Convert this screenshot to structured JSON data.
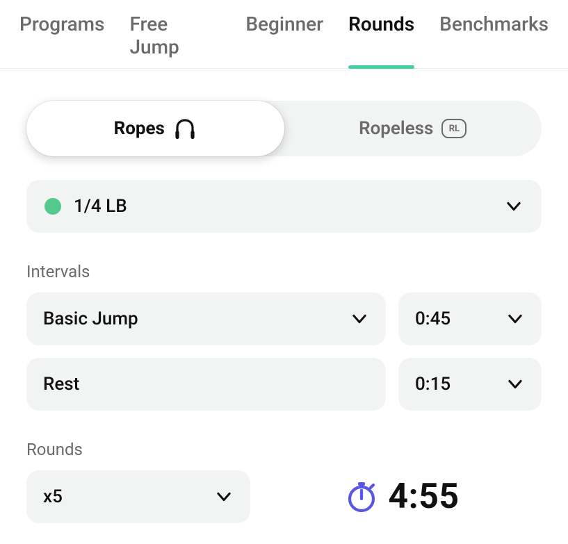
{
  "tabs": [
    {
      "label": "Programs"
    },
    {
      "label": "Free Jump"
    },
    {
      "label": "Beginner"
    },
    {
      "label": "Rounds"
    },
    {
      "label": "Benchmarks"
    }
  ],
  "activeTabIndex": 3,
  "segmented": {
    "ropes": "Ropes",
    "ropeless": "Ropeless",
    "ropeless_badge": "RL"
  },
  "weight": {
    "label": "1/4 LB",
    "color": "#54c98e"
  },
  "intervals": {
    "heading": "Intervals",
    "items": [
      {
        "exercise": "Basic Jump",
        "time": "0:45",
        "hasExerciseChevron": true
      },
      {
        "exercise": "Rest",
        "time": "0:15",
        "hasExerciseChevron": false
      }
    ]
  },
  "rounds": {
    "heading": "Rounds",
    "value": "x5"
  },
  "total_time": "4:55"
}
